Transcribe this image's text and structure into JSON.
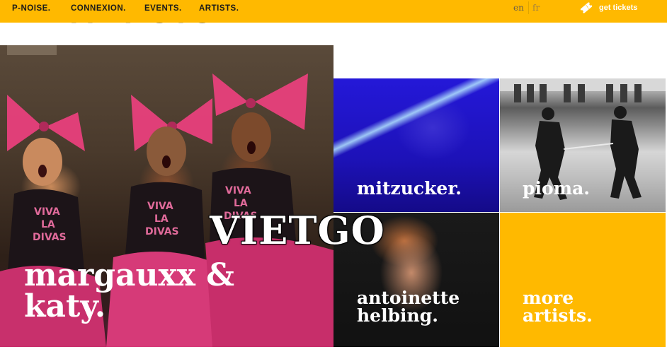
{
  "nav": {
    "items": [
      "P-NOISE.",
      "CONNEXION.",
      "EVENTS.",
      "ARTISTS."
    ],
    "languages": [
      "en",
      "fr"
    ],
    "tickets_label": "get tickets",
    "tickets_icon": "ticket-icon",
    "background_color": "#ffb900"
  },
  "page": {
    "heading": "ARTISTS"
  },
  "artists": [
    {
      "name_line1": "margauxx &",
      "name_line2": "katy."
    },
    {
      "name_line1": "mitzucker."
    },
    {
      "name_line1": "pioma."
    },
    {
      "name_line1": "antoinette",
      "name_line2": "helbing."
    }
  ],
  "more": {
    "line1": "more",
    "line2": "artists.",
    "color": "#ffb900"
  },
  "watermark": {
    "text": "VIETGO"
  }
}
